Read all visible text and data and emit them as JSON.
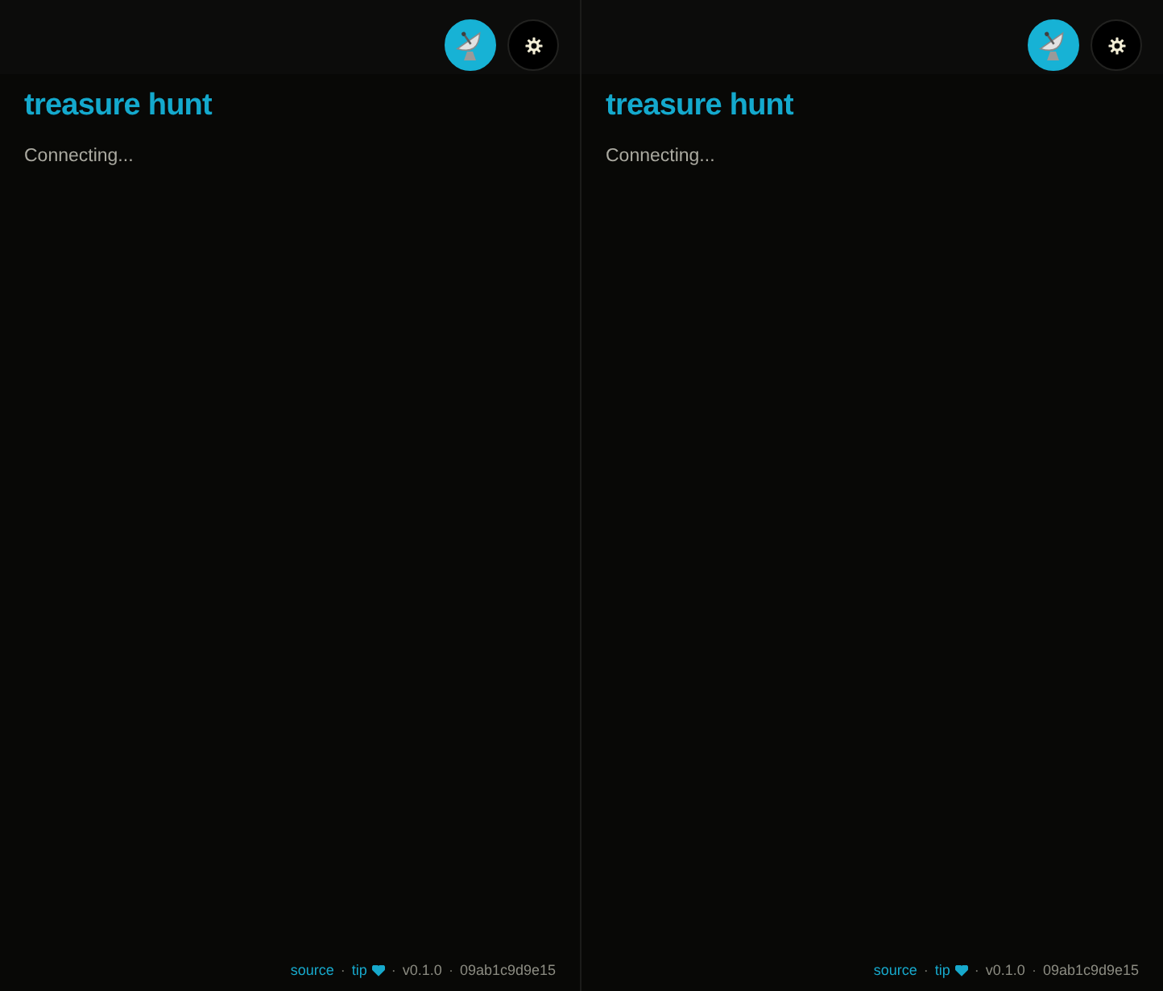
{
  "panes": [
    {
      "header": {
        "buttons": [
          {
            "kind": "dish",
            "on": true
          },
          {
            "kind": "settings",
            "on": false
          }
        ]
      },
      "title": "treasure hunt",
      "status": "Connecting...",
      "footer": [
        {
          "kind": "link",
          "label": "source"
        },
        {
          "kind": "separator",
          "text": "·"
        },
        {
          "kind": "heart_link",
          "label": "tip"
        },
        {
          "kind": "separator",
          "text": "·"
        },
        {
          "kind": "text",
          "text": "v0.1.0"
        },
        {
          "kind": "separator",
          "text": "·"
        },
        {
          "kind": "text",
          "text": "09ab1c9d9e15"
        }
      ]
    },
    {
      "header": {
        "buttons": [
          {
            "kind": "dish",
            "on": true
          },
          {
            "kind": "settings",
            "on": false
          }
        ]
      },
      "title": "treasure hunt",
      "status": "Connecting...",
      "footer": [
        {
          "kind": "link",
          "label": "source"
        },
        {
          "kind": "separator",
          "text": "·"
        },
        {
          "kind": "heart_link",
          "label": "tip"
        },
        {
          "kind": "separator",
          "text": "·"
        },
        {
          "kind": "text",
          "text": "v0.1.0"
        },
        {
          "kind": "separator",
          "text": "·"
        },
        {
          "kind": "text",
          "text": "09ab1c9d9e15"
        }
      ]
    }
  ]
}
